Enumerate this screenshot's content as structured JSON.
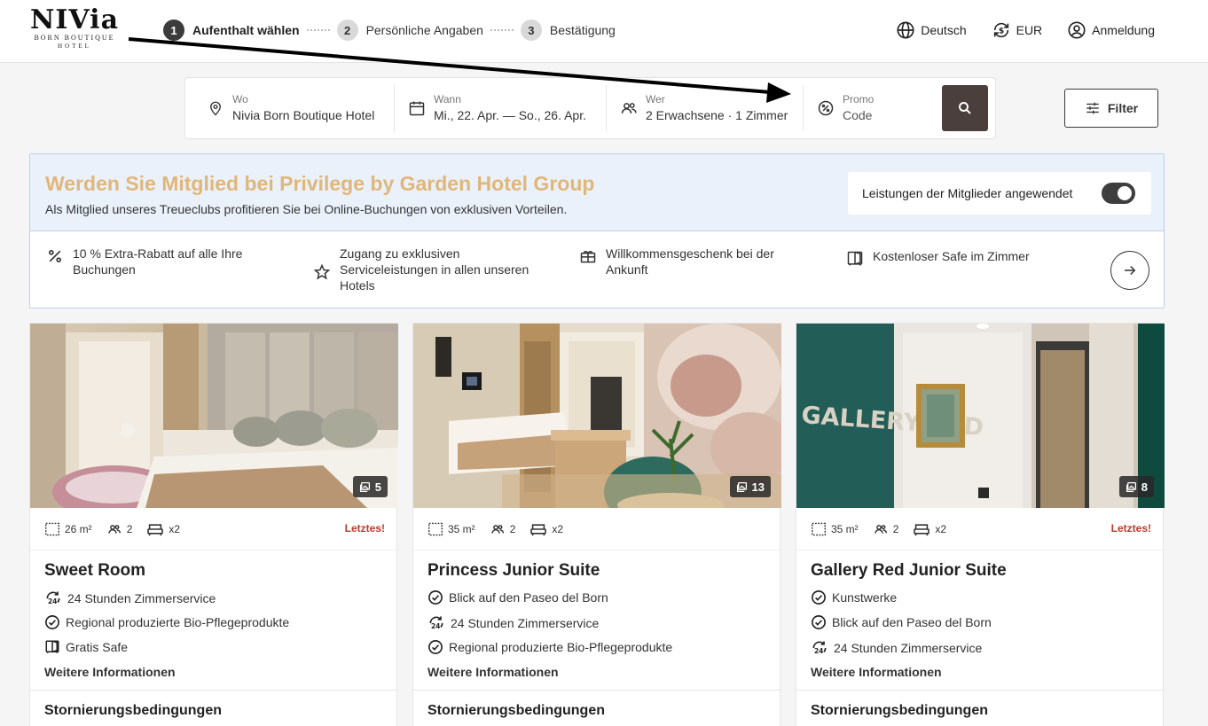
{
  "logo": {
    "main": "NIVia",
    "line1": "BORN BOUTIQUE",
    "line2": "HOTEL"
  },
  "steps": [
    {
      "num": "1",
      "label": "Aufenthalt wählen",
      "active": true
    },
    {
      "num": "2",
      "label": "Persönliche Angaben"
    },
    {
      "num": "3",
      "label": "Bestätigung"
    }
  ],
  "header": {
    "language": "Deutsch",
    "currency": "EUR",
    "login": "Anmeldung"
  },
  "search": {
    "where_label": "Wo",
    "where_value": "Nivia Born Boutique Hotel",
    "when_label": "Wann",
    "when_value": "Mi., 22. Apr. — So., 26. Apr.",
    "who_label": "Wer",
    "who_value": "2 Erwachsene · 1 Zimmer",
    "promo_label": "Promo",
    "promo_value": "Code"
  },
  "filter_label": "Filter",
  "membership": {
    "title": "Werden Sie Mitglied bei Privilege by Garden Hotel Group",
    "subtitle": "Als Mitglied unseres Treueclubs profitieren Sie bei Online-Buchungen von exklusiven Vorteilen.",
    "toggle_label": "Leistungen der Mitglieder angewendet",
    "benefits": [
      {
        "line1": "10 % Extra-Rabatt auf alle Ihre",
        "line2": "Buchungen",
        "icon": "percent-icon"
      },
      {
        "line1": "Zugang zu exklusiven",
        "line2": "Serviceleistungen in allen unseren",
        "line3": "Hotels",
        "icon": "star-icon"
      },
      {
        "line1": "Willkommensgeschenk bei der",
        "line2": "Ankunft",
        "icon": "gift-icon"
      },
      {
        "line1": "Kostenloser Safe im Zimmer",
        "icon": "safe-icon"
      }
    ]
  },
  "rooms": [
    {
      "name": "Sweet Room",
      "photos": "5",
      "area": "26 m²",
      "guests": "2",
      "beds": "x2",
      "badge": "Letztes!",
      "features": [
        "24 Stunden Zimmerservice",
        "Regional produzierte Bio-Pflegeprodukte",
        "Gratis Safe"
      ],
      "more": "Weitere Informationen",
      "cancel": "Stornierungsbedingungen"
    },
    {
      "name": "Princess Junior Suite",
      "photos": "13",
      "area": "35 m²",
      "guests": "2",
      "beds": "x2",
      "badge": "",
      "features": [
        "Blick auf den Paseo del Born",
        "24 Stunden Zimmerservice",
        "Regional produzierte Bio-Pflegeprodukte"
      ],
      "more": "Weitere Informationen",
      "cancel": "Stornierungsbedingungen"
    },
    {
      "name": "Gallery Red Junior Suite",
      "photos": "8",
      "area": "35 m²",
      "guests": "2",
      "beds": "x2",
      "badge": "Letztes!",
      "features": [
        "Kunstwerke",
        "Blick auf den Paseo del Born",
        "24 Stunden Zimmerservice"
      ],
      "more": "Weitere Informationen",
      "cancel": "Stornierungsbedingungen",
      "wall_text": "GALLERY RED"
    }
  ],
  "colors": {
    "accent_gold": "#e0b77a",
    "search_button": "#4a3f3c",
    "last_badge": "#c0392b"
  }
}
